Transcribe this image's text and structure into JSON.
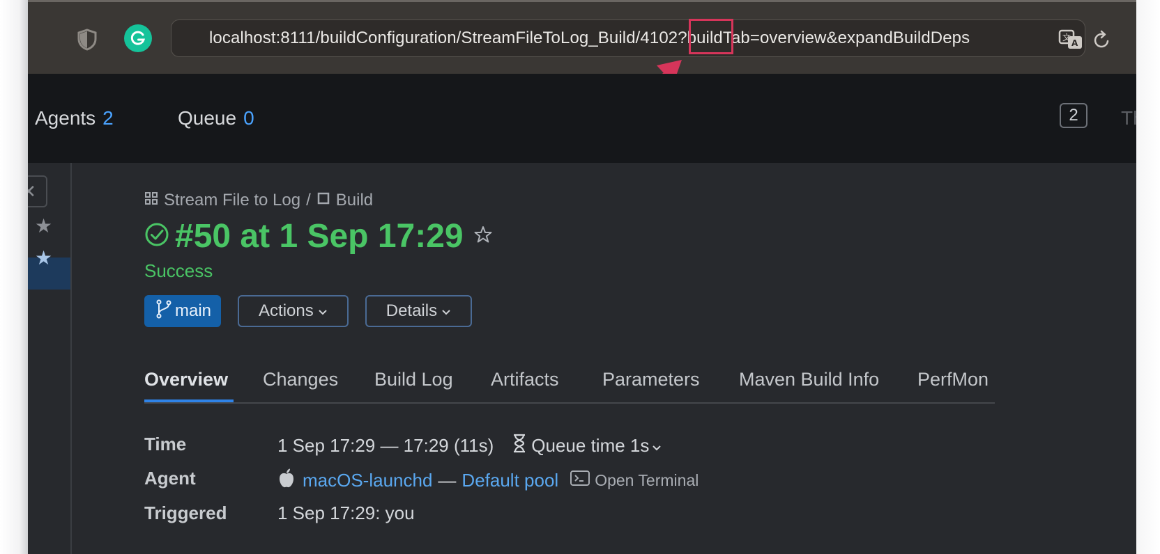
{
  "browser": {
    "url": "localhost:8111/buildConfiguration/StreamFileToLog_Build/4102?buildTab=overview&expandBuildDeps",
    "highlighted_segment": "4102"
  },
  "header": {
    "agents_label": "Agents",
    "agents_count": "2",
    "queue_label": "Queue",
    "queue_count": "0",
    "notification_count": "2",
    "cut_text": "The"
  },
  "breadcrumb": {
    "project": "Stream File to Log",
    "separator": "/",
    "build_config": "Build"
  },
  "build": {
    "title": "#50 at 1 Sep 17:29",
    "status": "Success",
    "status_color": "#4ac565",
    "branch": "main",
    "actions_label": "Actions",
    "details_label": "Details"
  },
  "tabs": [
    {
      "label": "Overview",
      "active": true
    },
    {
      "label": "Changes"
    },
    {
      "label": "Build Log"
    },
    {
      "label": "Artifacts"
    },
    {
      "label": "Parameters"
    },
    {
      "label": "Maven Build Info"
    },
    {
      "label": "PerfMon"
    }
  ],
  "info": {
    "time_label": "Time",
    "time_value": "1 Sep 17:29 — 17:29 (11s)",
    "queue_time": "Queue time 1s",
    "agent_label": "Agent",
    "agent_name": "macOS-launchd",
    "agent_sep": "—",
    "agent_pool": "Default pool",
    "open_terminal": "Open Terminal",
    "triggered_label": "Triggered",
    "triggered_value": "1 Sep 17:29: you"
  },
  "colors": {
    "accent": "#2f83e8",
    "success": "#4ac565",
    "annotation": "#d6355a"
  }
}
